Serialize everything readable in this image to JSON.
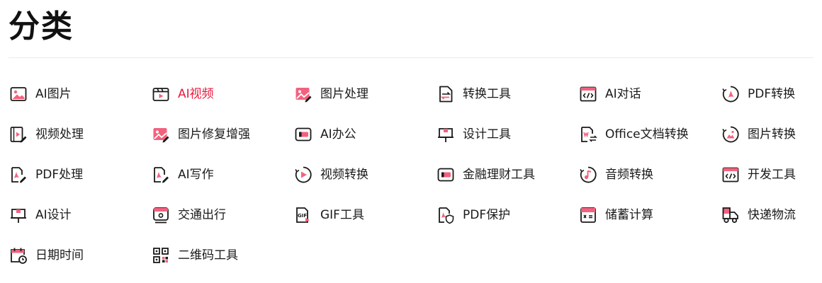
{
  "page": {
    "title": "分类"
  },
  "theme": {
    "accent": "#e8193c",
    "icon_stroke": "#1a1a1a",
    "icon_accent": "#f2627e"
  },
  "categories": [
    {
      "label": "AI图片",
      "icon": "image-icon",
      "active": false
    },
    {
      "label": "AI视频",
      "icon": "video-clapper-icon",
      "active": true
    },
    {
      "label": "图片处理",
      "icon": "image-edit-icon",
      "active": false
    },
    {
      "label": "转换工具",
      "icon": "convert-doc-icon",
      "active": false
    },
    {
      "label": "AI对话",
      "icon": "code-window-icon",
      "active": false
    },
    {
      "label": "PDF转换",
      "icon": "pdf-convert-icon",
      "active": false
    },
    {
      "label": "视频处理",
      "icon": "video-edit-icon",
      "active": false
    },
    {
      "label": "图片修复增强",
      "icon": "image-repair-icon",
      "active": false
    },
    {
      "label": "AI办公",
      "icon": "office-card-icon",
      "active": false
    },
    {
      "label": "设计工具",
      "icon": "design-board-icon",
      "active": false
    },
    {
      "label": "Office文档转换",
      "icon": "word-convert-icon",
      "active": false
    },
    {
      "label": "图片转换",
      "icon": "image-convert-icon",
      "active": false
    },
    {
      "label": "PDF处理",
      "icon": "pdf-edit-icon",
      "active": false
    },
    {
      "label": "AI写作",
      "icon": "pdf-write-icon",
      "active": false
    },
    {
      "label": "视频转换",
      "icon": "video-convert-icon",
      "active": false
    },
    {
      "label": "金融理财工具",
      "icon": "finance-card-icon",
      "active": false
    },
    {
      "label": "音频转换",
      "icon": "audio-convert-icon",
      "active": false
    },
    {
      "label": "开发工具",
      "icon": "dev-window-icon",
      "active": false
    },
    {
      "label": "AI设计",
      "icon": "ai-design-board-icon",
      "active": false
    },
    {
      "label": "交通出行",
      "icon": "train-icon",
      "active": false
    },
    {
      "label": "GIF工具",
      "icon": "gif-file-icon",
      "active": false
    },
    {
      "label": "PDF保护",
      "icon": "pdf-shield-icon",
      "active": false
    },
    {
      "label": "储蓄计算",
      "icon": "calculator-icon",
      "active": false
    },
    {
      "label": "快递物流",
      "icon": "delivery-truck-icon",
      "active": false
    },
    {
      "label": "日期时间",
      "icon": "calendar-clock-icon",
      "active": false
    },
    {
      "label": "二维码工具",
      "icon": "qr-code-icon",
      "active": false
    }
  ]
}
